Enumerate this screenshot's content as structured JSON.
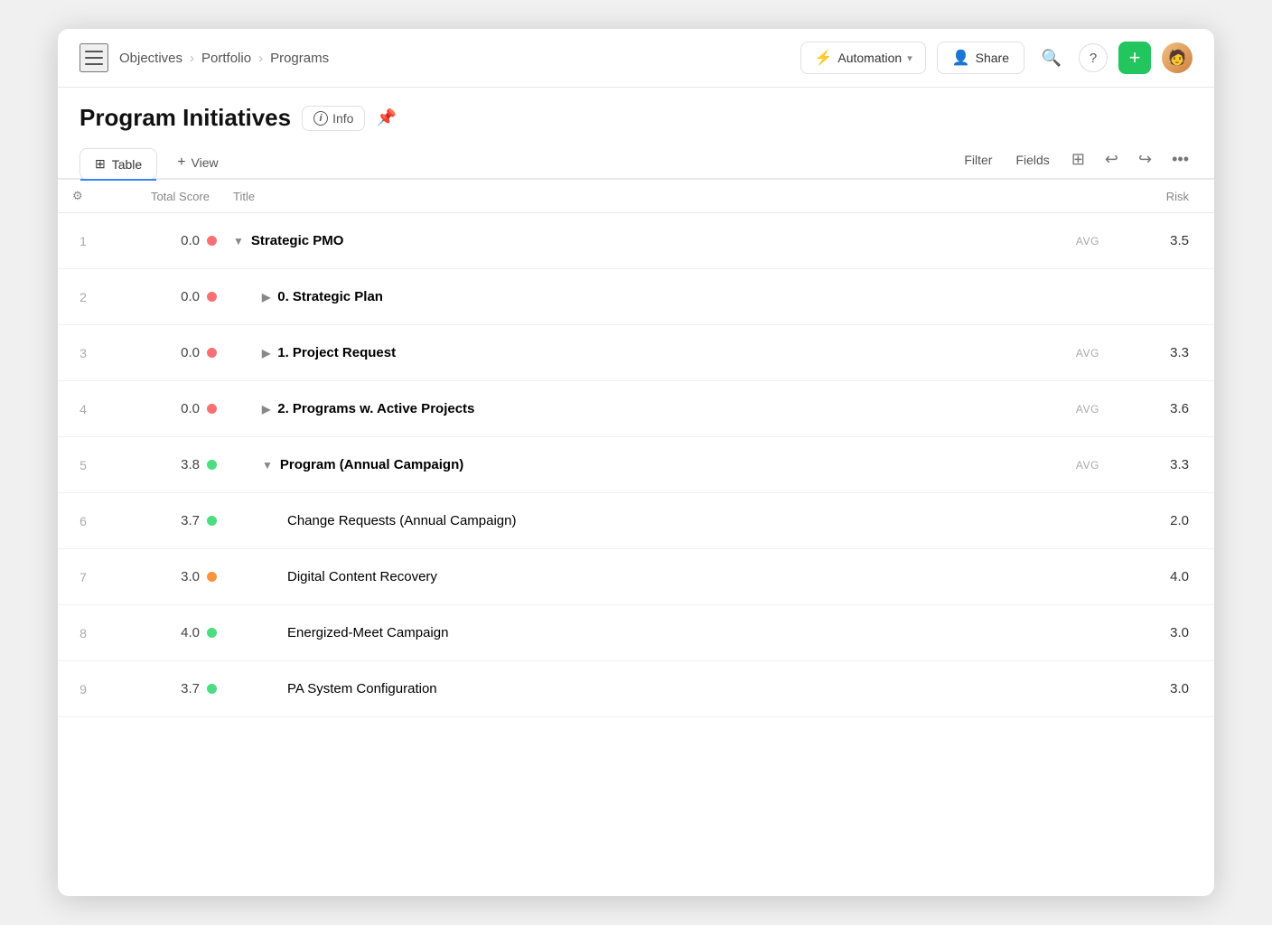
{
  "breadcrumb": {
    "items": [
      "Objectives",
      "Portfolio",
      "Programs"
    ]
  },
  "header": {
    "automation_label": "Automation",
    "share_label": "Share",
    "add_label": "+"
  },
  "page": {
    "title": "Program Initiatives",
    "info_label": "Info",
    "pin_icon": "📌"
  },
  "toolbar": {
    "table_label": "Table",
    "view_label": "View",
    "filter_label": "Filter",
    "fields_label": "Fields"
  },
  "table": {
    "columns": {
      "gear": "⚙",
      "total_score": "Total Score",
      "title": "Title",
      "avg": "",
      "risk": "Risk"
    },
    "rows": [
      {
        "num": "1",
        "score": "0.0",
        "dot": "red",
        "title": "Strategic PMO",
        "chevron": "▼",
        "bold": true,
        "indent": 0,
        "avg": "AVG",
        "risk": "3.5"
      },
      {
        "num": "2",
        "score": "0.0",
        "dot": "red",
        "title": "0. Strategic Plan",
        "chevron": "▶",
        "bold": true,
        "indent": 1,
        "avg": "",
        "risk": ""
      },
      {
        "num": "3",
        "score": "0.0",
        "dot": "red",
        "title": "1. Project Request",
        "chevron": "▶",
        "bold": true,
        "indent": 1,
        "avg": "AVG",
        "risk": "3.3"
      },
      {
        "num": "4",
        "score": "0.0",
        "dot": "red",
        "title": "2. Programs w. Active Projects",
        "chevron": "▶",
        "bold": true,
        "indent": 1,
        "avg": "AVG",
        "risk": "3.6"
      },
      {
        "num": "5",
        "score": "3.8",
        "dot": "green",
        "title": "Program (Annual Campaign)",
        "chevron": "▼",
        "bold": true,
        "indent": 1,
        "avg": "AVG",
        "risk": "3.3"
      },
      {
        "num": "6",
        "score": "3.7",
        "dot": "green",
        "title": "Change Requests (Annual Campaign)",
        "chevron": "",
        "bold": false,
        "indent": 2,
        "avg": "",
        "risk": "2.0"
      },
      {
        "num": "7",
        "score": "3.0",
        "dot": "orange",
        "title": "Digital Content Recovery",
        "chevron": "",
        "bold": false,
        "indent": 2,
        "avg": "",
        "risk": "4.0"
      },
      {
        "num": "8",
        "score": "4.0",
        "dot": "green",
        "title": "Energized-Meet Campaign",
        "chevron": "",
        "bold": false,
        "indent": 2,
        "avg": "",
        "risk": "3.0"
      },
      {
        "num": "9",
        "score": "3.7",
        "dot": "green",
        "title": "PA System Configuration",
        "chevron": "",
        "bold": false,
        "indent": 2,
        "avg": "",
        "risk": "3.0"
      }
    ]
  }
}
